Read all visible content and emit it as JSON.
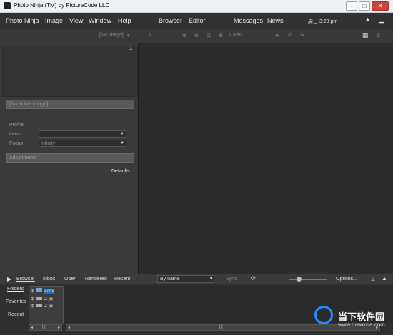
{
  "window": {
    "title": "Photo Ninja (TM) by PictureCode LLC"
  },
  "menubar": {
    "left": [
      "Photo Ninja",
      "Image",
      "View",
      "Window",
      "Help"
    ],
    "modes": [
      "Browser",
      "Editor"
    ],
    "right": [
      "Messages",
      "News"
    ],
    "clock": "周日 3:28 pm"
  },
  "toolbar": {
    "image_select": "[No image]",
    "zoom": "100%"
  },
  "left_panel": {
    "active_image": "[No active image]",
    "profile_label": "Profile",
    "lens_label": "Lens",
    "lens_value": "",
    "focus_label": "Focus",
    "focus_value": "Infinity",
    "adjustments_label": "Adjustments",
    "defaults_button": "Defaults..."
  },
  "browser_bar": {
    "tabs": [
      "Browser",
      "Inbox",
      "Open",
      "Rendered",
      "Recent"
    ],
    "sort": "By name",
    "sync": "Sync",
    "options": "Options..."
  },
  "bottom": {
    "side_tabs": [
      "Folders",
      "Favorites",
      "Recent"
    ],
    "folders": [
      "Admi",
      "C: 安",
      "D: 安"
    ]
  },
  "watermark": {
    "text": "当下软件园",
    "url": "www.downxia.com"
  },
  "colors": {
    "background": "#2b2b2b",
    "panel": "#3a3a3a",
    "accent": "#1e90ff"
  }
}
